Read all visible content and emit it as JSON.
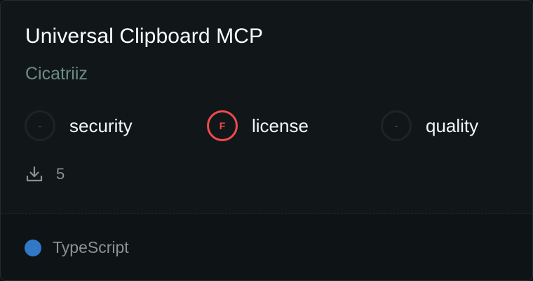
{
  "card": {
    "title": "Universal Clipboard MCP",
    "author": "Cicatriiz",
    "author_color": "#6d8c80",
    "scores": [
      {
        "grade": "-",
        "label": "security",
        "status": "neutral"
      },
      {
        "grade": "F",
        "label": "license",
        "status": "fail"
      },
      {
        "grade": "-",
        "label": "quality",
        "status": "neutral"
      }
    ],
    "downloads": {
      "icon": "download-icon",
      "count": "5"
    },
    "language": {
      "name": "TypeScript",
      "color": "#3178c6"
    }
  }
}
